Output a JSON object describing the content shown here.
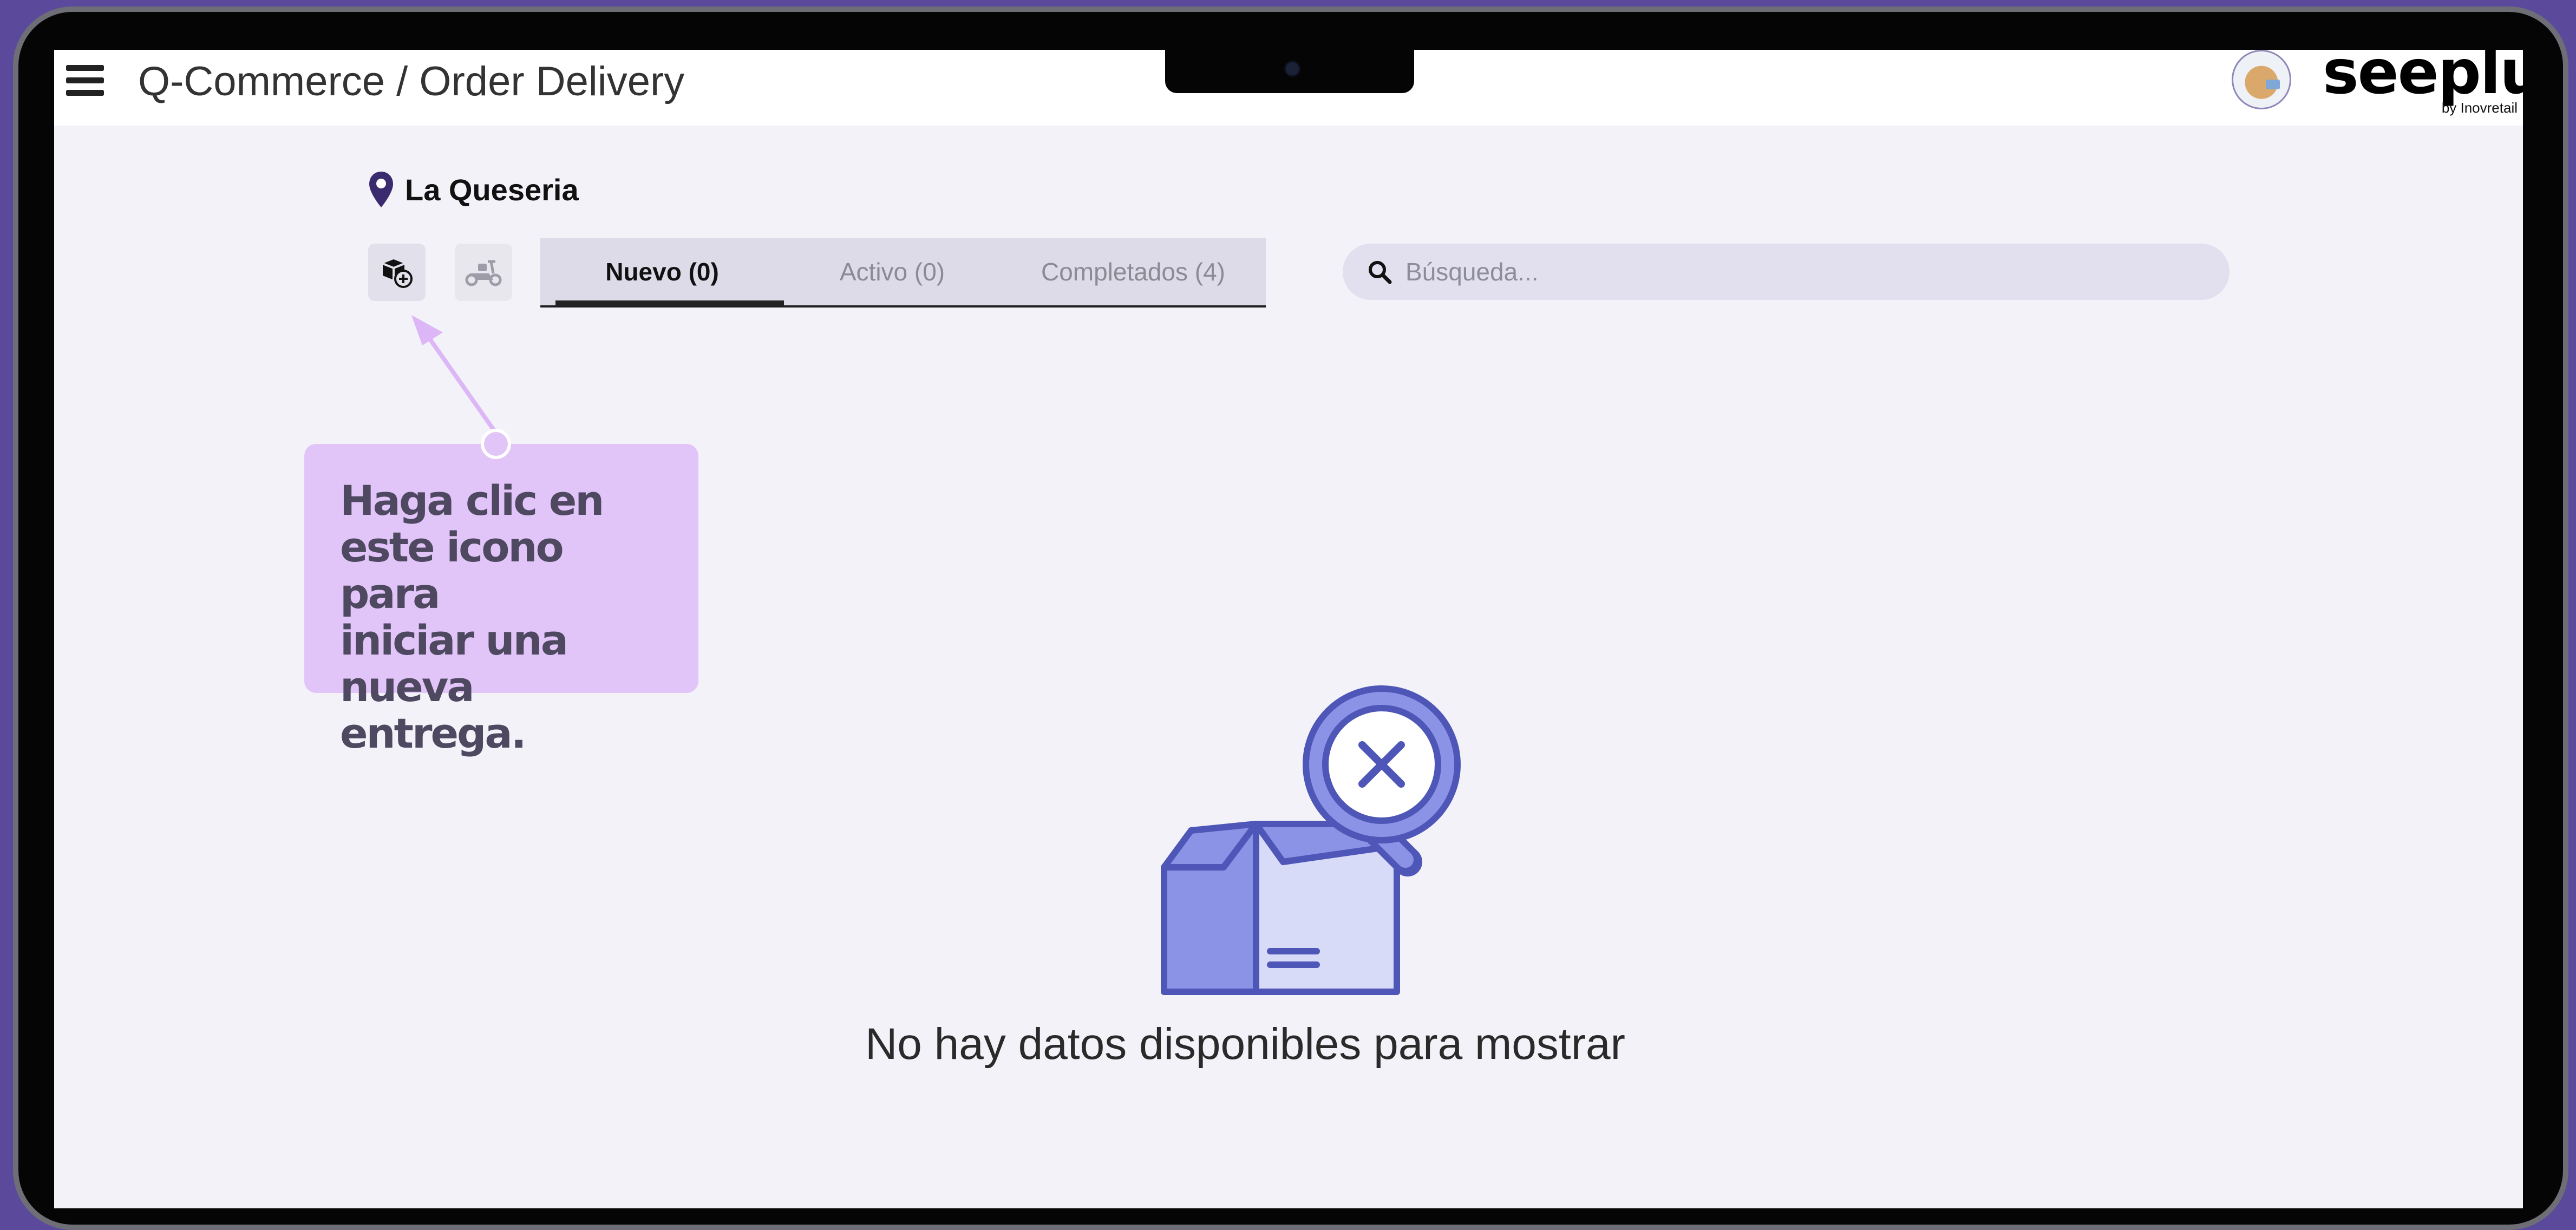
{
  "header": {
    "title": "Q-Commerce / Order Delivery",
    "logo": "seeplus",
    "logo_sub": "by Inovretail"
  },
  "location": {
    "name": "La Queseria",
    "icon": "map-pin-icon"
  },
  "toolbar": {
    "new_delivery_icon": "box-plus-icon",
    "scooter_icon": "scooter-icon"
  },
  "tabs": [
    {
      "label": "Nuevo (0)",
      "active": true
    },
    {
      "label": "Activo (0)",
      "active": false
    },
    {
      "label": "Completados (4)",
      "active": false
    }
  ],
  "search": {
    "placeholder": "Búsqueda..."
  },
  "tooltip": {
    "text": "Haga clic en\neste icono para\niniciar una\nnueva entrega."
  },
  "empty_state": {
    "message": "No hay datos disponibles para mostrar",
    "icon": "empty-box-search-icon"
  },
  "colors": {
    "accent": "#5b4a9c",
    "tooltip": "#e2c5f8",
    "illustration": "#4e56b8",
    "illustration_fill": "#8b93e6"
  }
}
